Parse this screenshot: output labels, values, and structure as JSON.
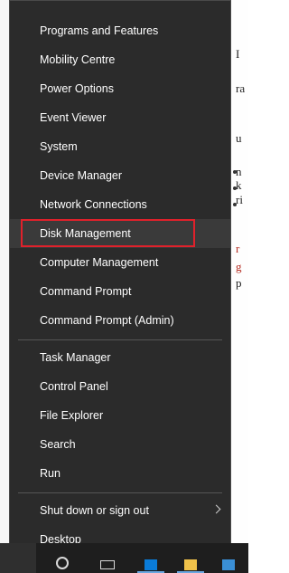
{
  "menu": {
    "group1": [
      {
        "label": "Programs and Features"
      },
      {
        "label": "Mobility Centre"
      },
      {
        "label": "Power Options"
      },
      {
        "label": "Event Viewer"
      },
      {
        "label": "System"
      },
      {
        "label": "Device Manager"
      },
      {
        "label": "Network Connections"
      },
      {
        "label": "Disk Management",
        "highlighted": true
      },
      {
        "label": "Computer Management"
      },
      {
        "label": "Command Prompt"
      },
      {
        "label": "Command Prompt (Admin)"
      }
    ],
    "group2": [
      {
        "label": "Task Manager"
      },
      {
        "label": "Control Panel"
      },
      {
        "label": "File Explorer"
      },
      {
        "label": "Search"
      },
      {
        "label": "Run"
      }
    ],
    "group3": [
      {
        "label": "Shut down or sign out",
        "has_submenu": true
      },
      {
        "label": "Desktop"
      }
    ]
  },
  "colors": {
    "menu_background": "#2b2b2b",
    "menu_text": "#ffffff",
    "highlight_border": "#e0212b",
    "separator": "#555555",
    "taskbar": "#1e1e1e"
  },
  "icons": {
    "submenu": "chevron-right-icon",
    "taskbar": [
      "start-icon",
      "search-icon",
      "task-view-icon",
      "edge-icon",
      "file-explorer-icon",
      "store-icon"
    ]
  }
}
